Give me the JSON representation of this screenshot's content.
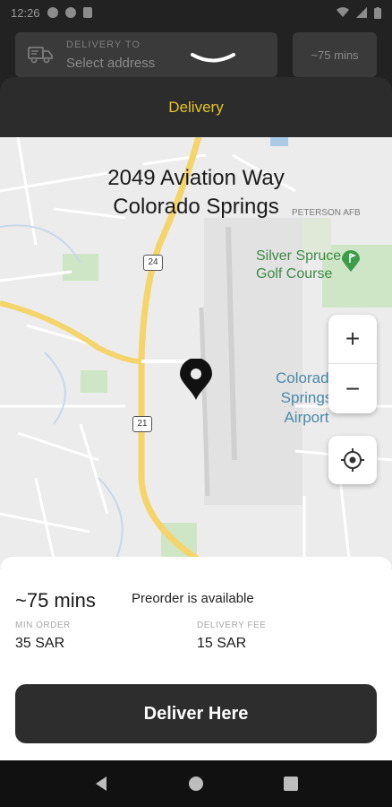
{
  "status_bar": {
    "time": "12:26"
  },
  "header": {
    "delivery_to_label": "DELIVERY TO",
    "address_placeholder": "Select address",
    "time_estimate": "~75 mins"
  },
  "sheet": {
    "title": "Delivery"
  },
  "map": {
    "address_line1": "2049 Aviation Way",
    "address_line2": "Colorado Springs",
    "poi_golf": "Silver Spruce\nGolf Course",
    "poi_airport": "Colorado\nSprings\nAirport",
    "poi_peterson": "PETERSON AFB",
    "route_24": "24",
    "route_21": "21",
    "zoom_in_label": "+",
    "zoom_out_label": "−"
  },
  "info": {
    "eta": "~75 mins",
    "preorder_text": "Preorder is available",
    "min_order_label": "MIN ORDER",
    "min_order_value": "35 SAR",
    "delivery_fee_label": "DELIVERY FEE",
    "delivery_fee_value": "15 SAR"
  },
  "cta": {
    "label": "Deliver Here"
  },
  "colors": {
    "accent": "#e5c32a",
    "cta_bg": "#2d2d2d",
    "sheet_bg": "#2c2c2c"
  }
}
